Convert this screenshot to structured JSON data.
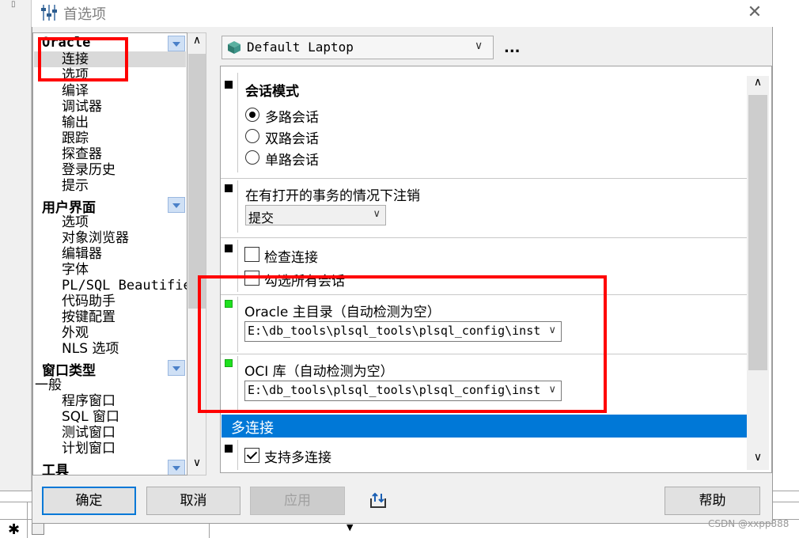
{
  "dialog": {
    "title": "首选项"
  },
  "tree": {
    "groups": [
      {
        "label": "Oracle",
        "items": [
          "连接",
          "选项",
          "编译",
          "调试器",
          "输出",
          "跟踪",
          "探查器",
          "登录历史",
          "提示"
        ],
        "selected": "连接"
      },
      {
        "label": "用户界面",
        "items": [
          "选项",
          "对象浏览器",
          "编辑器",
          "字体",
          "PL/SQL Beautifier",
          "代码助手",
          "按键配置",
          "外观",
          "NLS 选项"
        ]
      },
      {
        "label": "窗口类型",
        "plain": "一般",
        "items": [
          "程序窗口",
          "SQL 窗口",
          "测试窗口",
          "计划窗口"
        ]
      },
      {
        "label": "工具"
      }
    ]
  },
  "profile": {
    "value": "Default Laptop",
    "more": "..."
  },
  "sections": {
    "session_mode": {
      "title": "会话模式",
      "options": [
        "多路会话",
        "双路会话",
        "单路会话"
      ],
      "selected": "多路会话"
    },
    "logoff": {
      "title": "在有打开的事务的情况下注销",
      "value": "提交"
    },
    "check_conn": {
      "options": [
        "检查连接",
        "勾选所有会话"
      ]
    },
    "oracle_home": {
      "title": "Oracle 主目录（自动检测为空）",
      "value": "E:\\db_tools\\plsql_tools\\plsql_config\\inst"
    },
    "oci_lib": {
      "title": "OCI 库（自动检测为空）",
      "value": "E:\\db_tools\\plsql_tools\\plsql_config\\inst"
    },
    "multi": {
      "header": "多连接",
      "option": "支持多连接"
    }
  },
  "buttons": {
    "ok": "确定",
    "cancel": "取消",
    "apply": "应用",
    "help": "帮助"
  },
  "watermark": "CSDN @xxpp888",
  "colors": {
    "accent": "#0078d7",
    "annotation": "#ff0000",
    "marker_green": "#1fe01f"
  }
}
